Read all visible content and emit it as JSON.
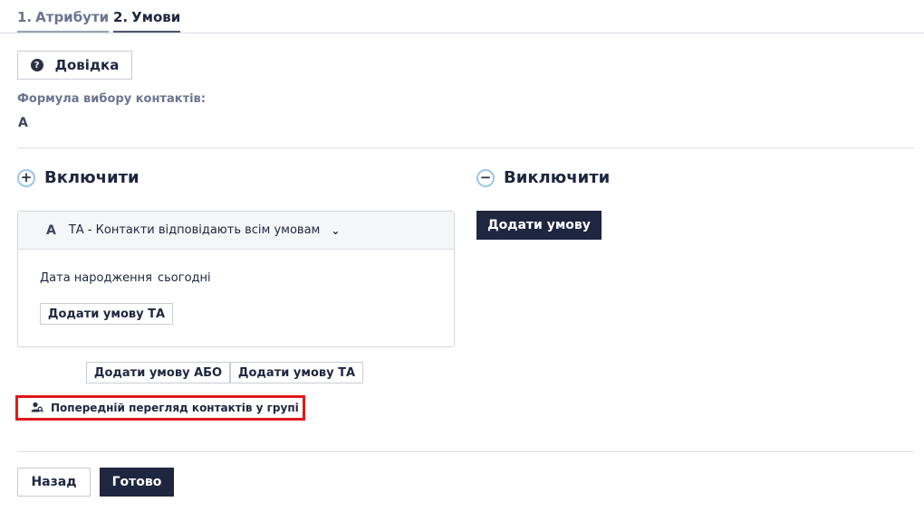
{
  "tabs": [
    {
      "num": "1.",
      "label": "Атрибути"
    },
    {
      "num": "2.",
      "label": "Умови"
    }
  ],
  "help_button": "Довідка",
  "formula": {
    "label": "Формула вибору контактів:",
    "value": "A"
  },
  "include": {
    "title": "Включити",
    "icon": "plus-circle-icon"
  },
  "exclude": {
    "title": "Виключити",
    "icon": "minus-circle-icon",
    "add_condition": "Додати умову"
  },
  "group": {
    "letter": "A",
    "type": "ТА - Контакти відповідають всім умовам",
    "condition": {
      "field": "Дата народження",
      "value": "сьогодні"
    },
    "add_and": "Додати умову ТА"
  },
  "add_or": "Додати умову АБО",
  "add_and_outer": "Додати умову ТА",
  "preview": "Попередній перегляд контактів у групі",
  "footer": {
    "back": "Назад",
    "done": "Готово"
  },
  "colors": {
    "primary": "#1f2640",
    "highlight": "#e0191b",
    "icon_ring": "#9cc5ea"
  }
}
